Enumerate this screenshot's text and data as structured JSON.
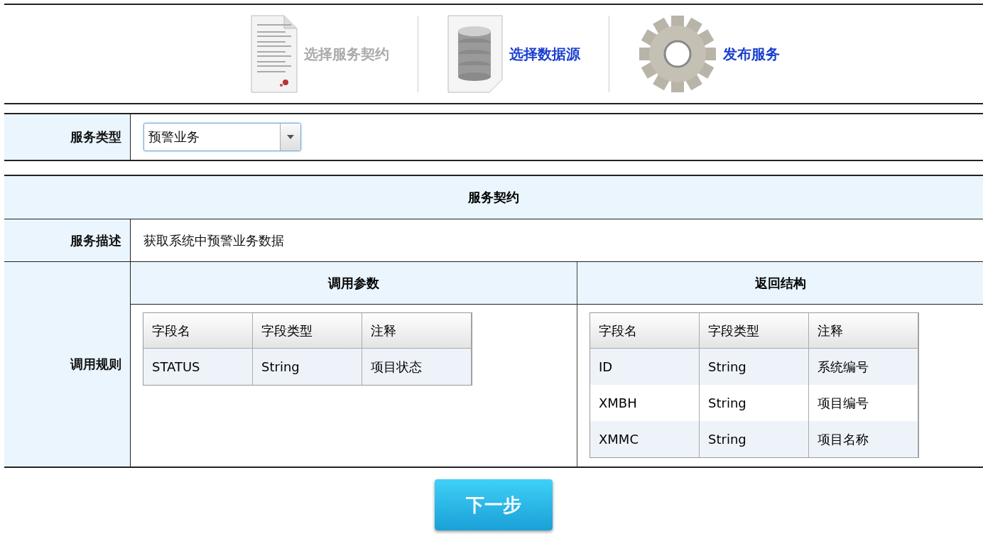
{
  "steps": [
    {
      "kind": "document",
      "label": "选择服务契约",
      "dimmed": true
    },
    {
      "kind": "database",
      "label": "选择数据源",
      "dimmed": false
    },
    {
      "kind": "gear",
      "label": "发布服务",
      "dimmed": false
    }
  ],
  "service_type": {
    "label": "服务类型",
    "value": "预警业务"
  },
  "contract": {
    "title": "服务契约",
    "description_label": "服务描述",
    "description": "获取系统中预警业务数据",
    "rules_label": "调用规则",
    "params": {
      "title": "调用参数",
      "columns": [
        "字段名",
        "字段类型",
        "注释"
      ],
      "rows": [
        [
          "STATUS",
          "String",
          "项目状态"
        ]
      ]
    },
    "result": {
      "title": "返回结构",
      "columns": [
        "字段名",
        "字段类型",
        "注释"
      ],
      "rows": [
        [
          "ID",
          "String",
          "系统编号"
        ],
        [
          "XMBH",
          "String",
          "项目编号"
        ],
        [
          "XMMC",
          "String",
          "项目名称"
        ]
      ]
    }
  },
  "next_button": "下一步"
}
